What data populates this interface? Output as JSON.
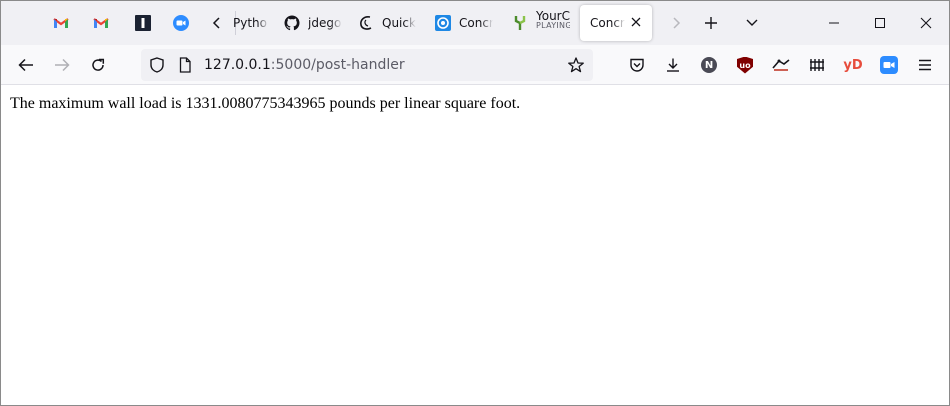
{
  "tabs": [
    {
      "icon": "gmail-icon",
      "title": ""
    },
    {
      "icon": "gmail-icon",
      "title": ""
    },
    {
      "icon": "instapaper-icon",
      "title": ""
    },
    {
      "icon": "zoom-icon",
      "title": ""
    },
    {
      "icon": "python-icon",
      "title": "Pytho"
    },
    {
      "icon": "github-icon",
      "title": "jdego"
    },
    {
      "icon": "quick-icon",
      "title": "Quick"
    },
    {
      "icon": "concrete-icon",
      "title": "Concr"
    },
    {
      "icon": "youtube-music-icon",
      "title": "YourC",
      "sublabel": "PLAYING"
    },
    {
      "icon": "",
      "title": "Concret",
      "active": true
    }
  ],
  "address": {
    "host": "127.0.0.1",
    "path": ":5000/post-handler"
  },
  "toolbar_icons": [
    "pocket-icon",
    "downloads-icon",
    "notion-icon",
    "ublock-icon",
    "extension-icon",
    "library-icon",
    "yd-icon",
    "zoom-extension-icon",
    "menu-icon"
  ],
  "yd_label": "yD",
  "notion_label": "N",
  "ublock_label": "uo",
  "page": {
    "text": "The maximum wall load is 1331.0080775343965 pounds per linear square foot."
  }
}
